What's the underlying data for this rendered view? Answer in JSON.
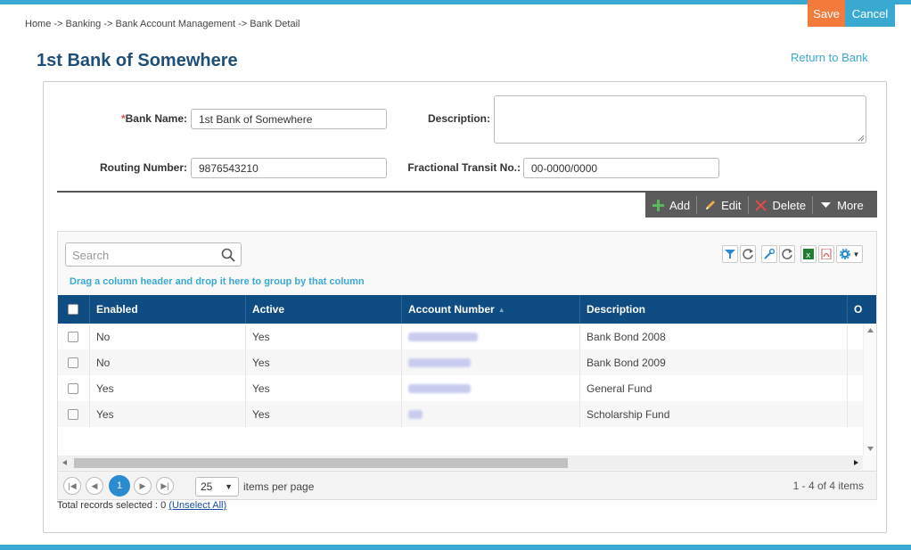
{
  "actions": {
    "save": "Save",
    "cancel": "Cancel"
  },
  "breadcrumb": "Home -> Banking -> Bank Account Management -> Bank Detail",
  "page_title": "1st Bank of Somewhere",
  "return_link": "Return to Bank",
  "form": {
    "bank_name_required": "*",
    "bank_name_label": "Bank Name:",
    "bank_name_value": "1st Bank of Somewhere",
    "description_label": "Description:",
    "description_value": "",
    "routing_label": "Routing Number:",
    "routing_value": "9876543210",
    "fractional_label": "Fractional Transit No.:",
    "fractional_value": "00-0000/0000"
  },
  "toolbar": {
    "add": "Add",
    "edit": "Edit",
    "delete": "Delete",
    "more": "More"
  },
  "grid": {
    "search_placeholder": "Search",
    "group_hint": "Drag a column header and drop it here to group by that column",
    "columns": [
      "Enabled",
      "Active",
      "Account Number",
      "Description",
      "O"
    ],
    "sorted_column": "Account Number",
    "sort_indicator": "▲",
    "rows": [
      {
        "enabled": "No",
        "active": "Yes",
        "account": "",
        "description": "Bank Bond 2008"
      },
      {
        "enabled": "No",
        "active": "Yes",
        "account": "",
        "description": "Bank Bond 2009"
      },
      {
        "enabled": "Yes",
        "active": "Yes",
        "account": "",
        "description": "General Fund"
      },
      {
        "enabled": "Yes",
        "active": "Yes",
        "account": "",
        "description": "Scholarship Fund"
      }
    ]
  },
  "pager": {
    "page": "1",
    "page_size": "25",
    "items_per_page": "items per page",
    "info": "1 - 4 of 4 items"
  },
  "selection": {
    "text": "Total records selected : 0",
    "unselect": "(Unselect All)"
  },
  "colors": {
    "accent": "#3aa9d1",
    "save": "#f47a3b",
    "header": "#0f4c81",
    "title": "#1f4e79"
  }
}
